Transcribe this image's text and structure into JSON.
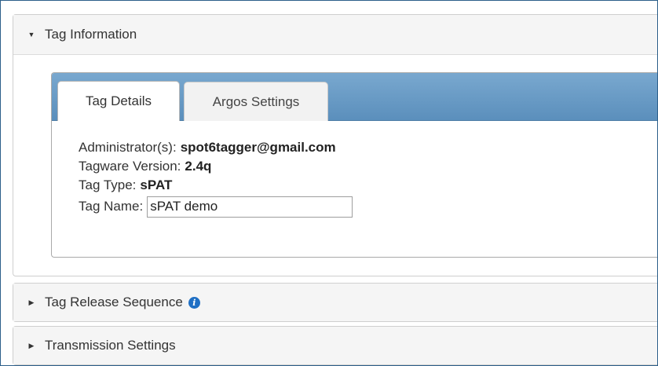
{
  "panels": {
    "tag_information": {
      "title": "Tag Information",
      "expanded_icon": "caret-down-icon",
      "tabs": [
        {
          "label": "Tag Details",
          "active": true
        },
        {
          "label": "Argos Settings",
          "active": false
        }
      ],
      "details": {
        "administrators_label": "Administrator(s):",
        "administrators_value": "spot6tagger@gmail.com",
        "tagware_label": "Tagware Version:",
        "tagware_value": "2.4q",
        "tag_type_label": "Tag Type:",
        "tag_type_value": "sPAT",
        "tag_name_label": "Tag Name:",
        "tag_name_value": "sPAT demo"
      }
    },
    "tag_release_sequence": {
      "title": "Tag Release Sequence",
      "collapsed_icon": "caret-right-icon",
      "info_icon": "info-icon"
    },
    "transmission_settings": {
      "title": "Transmission Settings",
      "collapsed_icon": "caret-right-icon"
    }
  },
  "colors": {
    "tab_strip": "#6b9cc6",
    "info_icon": "#1f6fc4",
    "panel_header": "#f5f5f5"
  }
}
